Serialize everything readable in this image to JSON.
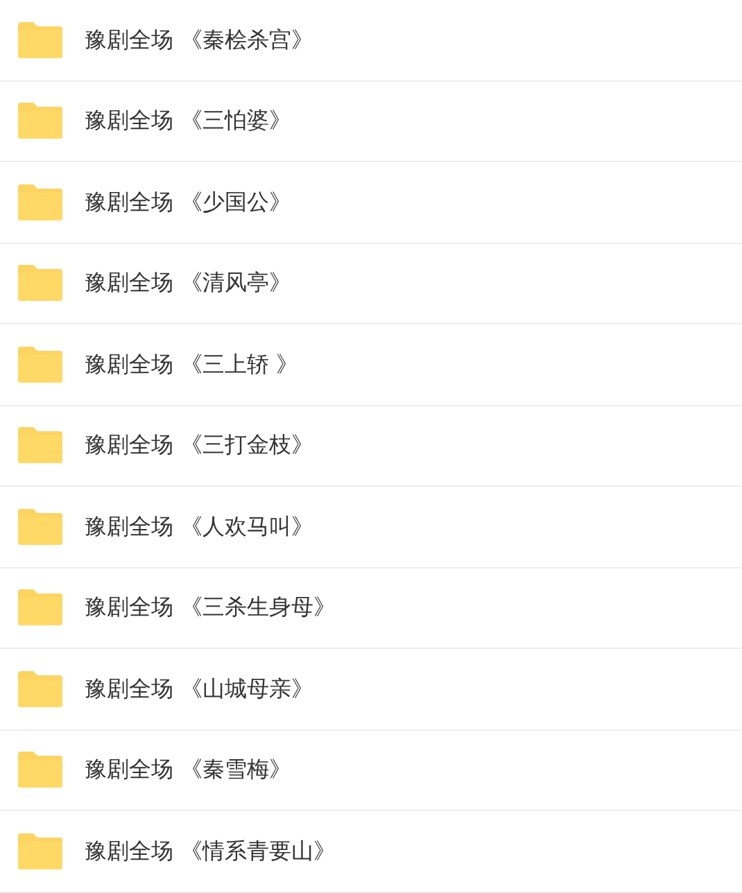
{
  "folders": [
    {
      "name": "豫剧全场 《秦桧杀宫》"
    },
    {
      "name": "豫剧全场 《三怕婆》"
    },
    {
      "name": "豫剧全场 《少国公》"
    },
    {
      "name": "豫剧全场 《清风亭》"
    },
    {
      "name": "豫剧全场 《三上轿 》"
    },
    {
      "name": "豫剧全场 《三打金枝》"
    },
    {
      "name": "豫剧全场 《人欢马叫》"
    },
    {
      "name": "豫剧全场 《三杀生身母》"
    },
    {
      "name": "豫剧全场 《山城母亲》"
    },
    {
      "name": "豫剧全场 《秦雪梅》"
    },
    {
      "name": "豫剧全场 《情系青要山》"
    }
  ]
}
